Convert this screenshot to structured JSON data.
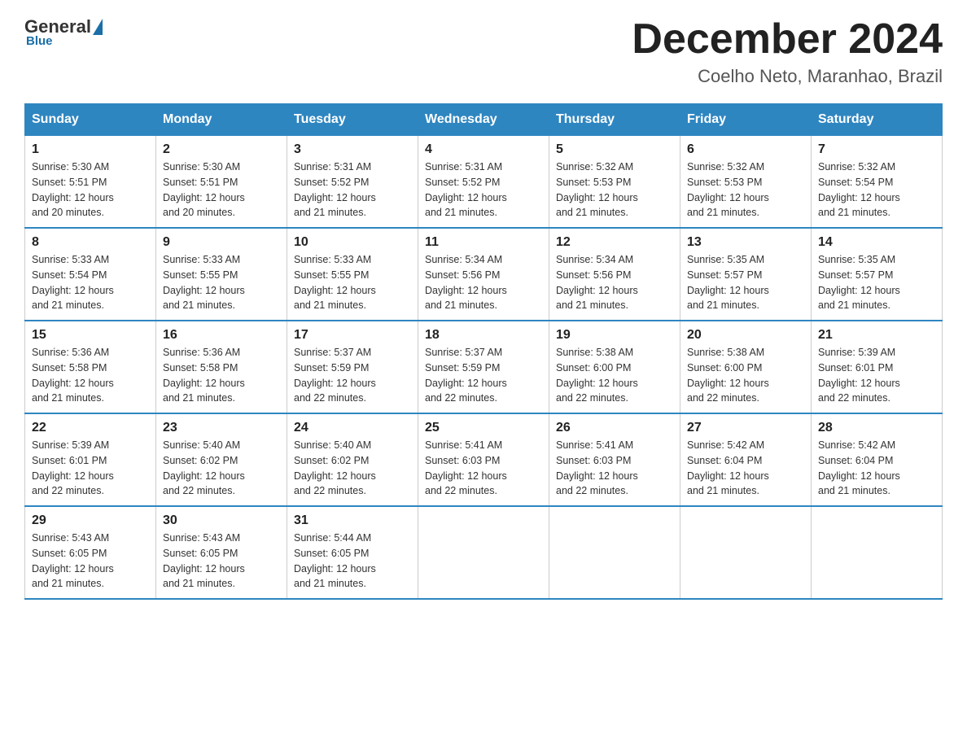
{
  "header": {
    "logo_general": "General",
    "logo_blue": "Blue",
    "month_title": "December 2024",
    "subtitle": "Coelho Neto, Maranhao, Brazil"
  },
  "days_of_week": [
    "Sunday",
    "Monday",
    "Tuesday",
    "Wednesday",
    "Thursday",
    "Friday",
    "Saturday"
  ],
  "weeks": [
    [
      {
        "day": "1",
        "info": "Sunrise: 5:30 AM\nSunset: 5:51 PM\nDaylight: 12 hours\nand 20 minutes."
      },
      {
        "day": "2",
        "info": "Sunrise: 5:30 AM\nSunset: 5:51 PM\nDaylight: 12 hours\nand 20 minutes."
      },
      {
        "day": "3",
        "info": "Sunrise: 5:31 AM\nSunset: 5:52 PM\nDaylight: 12 hours\nand 21 minutes."
      },
      {
        "day": "4",
        "info": "Sunrise: 5:31 AM\nSunset: 5:52 PM\nDaylight: 12 hours\nand 21 minutes."
      },
      {
        "day": "5",
        "info": "Sunrise: 5:32 AM\nSunset: 5:53 PM\nDaylight: 12 hours\nand 21 minutes."
      },
      {
        "day": "6",
        "info": "Sunrise: 5:32 AM\nSunset: 5:53 PM\nDaylight: 12 hours\nand 21 minutes."
      },
      {
        "day": "7",
        "info": "Sunrise: 5:32 AM\nSunset: 5:54 PM\nDaylight: 12 hours\nand 21 minutes."
      }
    ],
    [
      {
        "day": "8",
        "info": "Sunrise: 5:33 AM\nSunset: 5:54 PM\nDaylight: 12 hours\nand 21 minutes."
      },
      {
        "day": "9",
        "info": "Sunrise: 5:33 AM\nSunset: 5:55 PM\nDaylight: 12 hours\nand 21 minutes."
      },
      {
        "day": "10",
        "info": "Sunrise: 5:33 AM\nSunset: 5:55 PM\nDaylight: 12 hours\nand 21 minutes."
      },
      {
        "day": "11",
        "info": "Sunrise: 5:34 AM\nSunset: 5:56 PM\nDaylight: 12 hours\nand 21 minutes."
      },
      {
        "day": "12",
        "info": "Sunrise: 5:34 AM\nSunset: 5:56 PM\nDaylight: 12 hours\nand 21 minutes."
      },
      {
        "day": "13",
        "info": "Sunrise: 5:35 AM\nSunset: 5:57 PM\nDaylight: 12 hours\nand 21 minutes."
      },
      {
        "day": "14",
        "info": "Sunrise: 5:35 AM\nSunset: 5:57 PM\nDaylight: 12 hours\nand 21 minutes."
      }
    ],
    [
      {
        "day": "15",
        "info": "Sunrise: 5:36 AM\nSunset: 5:58 PM\nDaylight: 12 hours\nand 21 minutes."
      },
      {
        "day": "16",
        "info": "Sunrise: 5:36 AM\nSunset: 5:58 PM\nDaylight: 12 hours\nand 21 minutes."
      },
      {
        "day": "17",
        "info": "Sunrise: 5:37 AM\nSunset: 5:59 PM\nDaylight: 12 hours\nand 22 minutes."
      },
      {
        "day": "18",
        "info": "Sunrise: 5:37 AM\nSunset: 5:59 PM\nDaylight: 12 hours\nand 22 minutes."
      },
      {
        "day": "19",
        "info": "Sunrise: 5:38 AM\nSunset: 6:00 PM\nDaylight: 12 hours\nand 22 minutes."
      },
      {
        "day": "20",
        "info": "Sunrise: 5:38 AM\nSunset: 6:00 PM\nDaylight: 12 hours\nand 22 minutes."
      },
      {
        "day": "21",
        "info": "Sunrise: 5:39 AM\nSunset: 6:01 PM\nDaylight: 12 hours\nand 22 minutes."
      }
    ],
    [
      {
        "day": "22",
        "info": "Sunrise: 5:39 AM\nSunset: 6:01 PM\nDaylight: 12 hours\nand 22 minutes."
      },
      {
        "day": "23",
        "info": "Sunrise: 5:40 AM\nSunset: 6:02 PM\nDaylight: 12 hours\nand 22 minutes."
      },
      {
        "day": "24",
        "info": "Sunrise: 5:40 AM\nSunset: 6:02 PM\nDaylight: 12 hours\nand 22 minutes."
      },
      {
        "day": "25",
        "info": "Sunrise: 5:41 AM\nSunset: 6:03 PM\nDaylight: 12 hours\nand 22 minutes."
      },
      {
        "day": "26",
        "info": "Sunrise: 5:41 AM\nSunset: 6:03 PM\nDaylight: 12 hours\nand 22 minutes."
      },
      {
        "day": "27",
        "info": "Sunrise: 5:42 AM\nSunset: 6:04 PM\nDaylight: 12 hours\nand 21 minutes."
      },
      {
        "day": "28",
        "info": "Sunrise: 5:42 AM\nSunset: 6:04 PM\nDaylight: 12 hours\nand 21 minutes."
      }
    ],
    [
      {
        "day": "29",
        "info": "Sunrise: 5:43 AM\nSunset: 6:05 PM\nDaylight: 12 hours\nand 21 minutes."
      },
      {
        "day": "30",
        "info": "Sunrise: 5:43 AM\nSunset: 6:05 PM\nDaylight: 12 hours\nand 21 minutes."
      },
      {
        "day": "31",
        "info": "Sunrise: 5:44 AM\nSunset: 6:05 PM\nDaylight: 12 hours\nand 21 minutes."
      },
      {
        "day": "",
        "info": ""
      },
      {
        "day": "",
        "info": ""
      },
      {
        "day": "",
        "info": ""
      },
      {
        "day": "",
        "info": ""
      }
    ]
  ]
}
